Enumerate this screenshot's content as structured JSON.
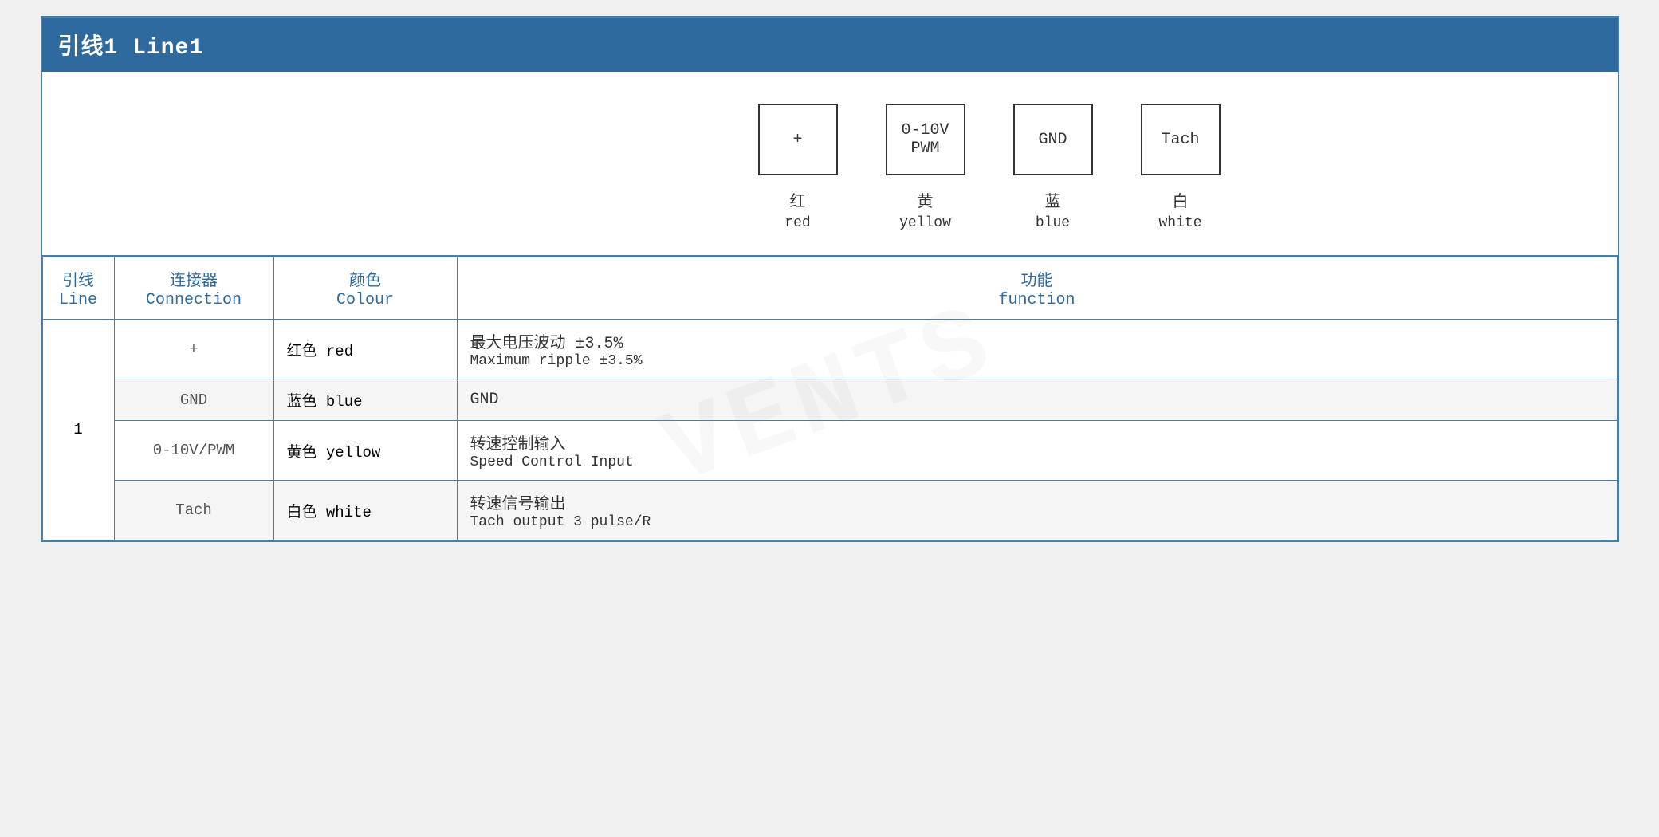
{
  "header": {
    "title": "引线1 Line1"
  },
  "diagram": {
    "connectors": [
      {
        "id": "plus",
        "box_label": "+",
        "label_zh": "红",
        "label_en": "red"
      },
      {
        "id": "pwm",
        "box_label": "0-10V\nPWM",
        "label_zh": "黄",
        "label_en": "yellow"
      },
      {
        "id": "gnd",
        "box_label": "GND",
        "label_zh": "蓝",
        "label_en": "blue"
      },
      {
        "id": "tach",
        "box_label": "Tach",
        "label_zh": "白",
        "label_en": "white"
      }
    ]
  },
  "table": {
    "headers": {
      "line_zh": "引线",
      "line_en": "Line",
      "connection_zh": "连接器",
      "connection_en": "Connection",
      "colour_zh": "颜色",
      "colour_en": "Colour",
      "function_zh": "功能",
      "function_en": "function"
    },
    "rows": [
      {
        "line": "1",
        "connection": "+",
        "colour_zh": "红色",
        "colour_en": "red",
        "function_zh": "最大电压波动 ±3.5%",
        "function_en": "Maximum ripple ±3.5%",
        "shaded": false
      },
      {
        "line": "",
        "connection": "GND",
        "colour_zh": "蓝色",
        "colour_en": "blue",
        "function_zh": "GND",
        "function_en": "",
        "shaded": true
      },
      {
        "line": "",
        "connection": "0-10V/PWM",
        "colour_zh": "黄色",
        "colour_en": "yellow",
        "function_zh": "转速控制输入",
        "function_en": "Speed Control Input",
        "shaded": false
      },
      {
        "line": "",
        "connection": "Tach",
        "colour_zh": "白色",
        "colour_en": "white",
        "function_zh": "转速信号输出",
        "function_en": "Tach output 3 pulse/R",
        "shaded": true
      }
    ]
  },
  "watermark_text": "VENTS"
}
